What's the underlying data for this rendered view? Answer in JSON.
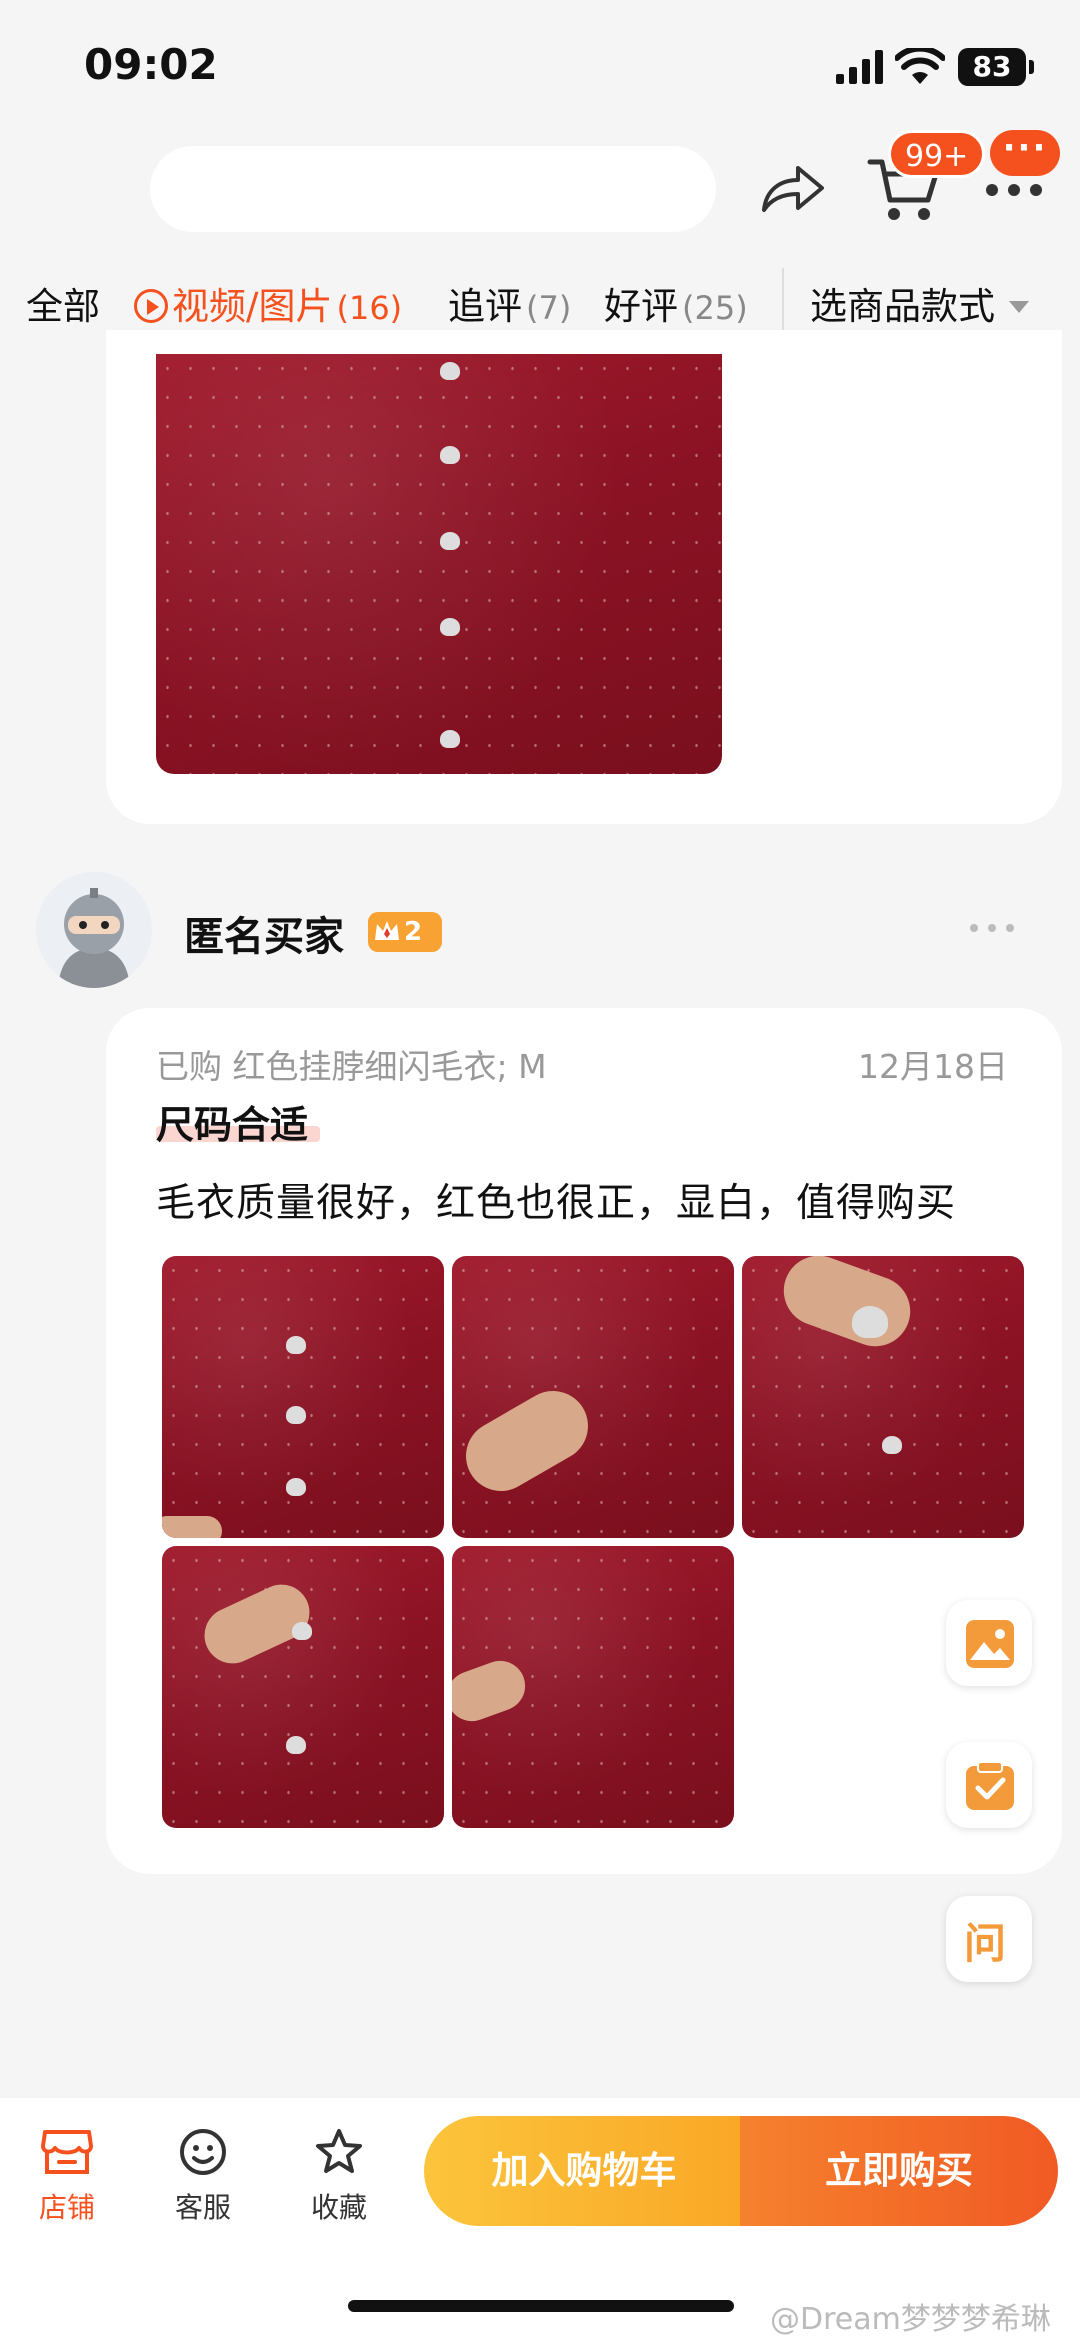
{
  "status_bar": {
    "time": "09:02",
    "battery": "83"
  },
  "nav": {
    "cart_badge": "99+",
    "more_badge": "···"
  },
  "tabs": [
    {
      "label": "全部",
      "count": ""
    },
    {
      "label": "视频/图片",
      "count": "(16)"
    },
    {
      "label": "追评",
      "count": "(7)"
    },
    {
      "label": "好评",
      "count": "(25)"
    }
  ],
  "style_selector": {
    "label": "选商品款式"
  },
  "review": {
    "reviewer_name": "匿名买家",
    "level": "2",
    "purchase_info": "已购  红色挂脖细闪毛衣; M",
    "date": "12月18日",
    "title": "尺码合适",
    "text": "毛衣质量很好，红色也很正，显白，值得购买",
    "photo_count": 5
  },
  "floating": {
    "ask_label": "问"
  },
  "bottom_bar": {
    "store": "店铺",
    "service": "客服",
    "favorite": "收藏",
    "add_to_cart": "加入购物车",
    "buy_now": "立即购买"
  },
  "watermark": "@Dream梦梦梦希琳",
  "colors": {
    "accent": "#f4511e",
    "cart_button": "#fcc43c",
    "buy_button": "#f15a24"
  }
}
